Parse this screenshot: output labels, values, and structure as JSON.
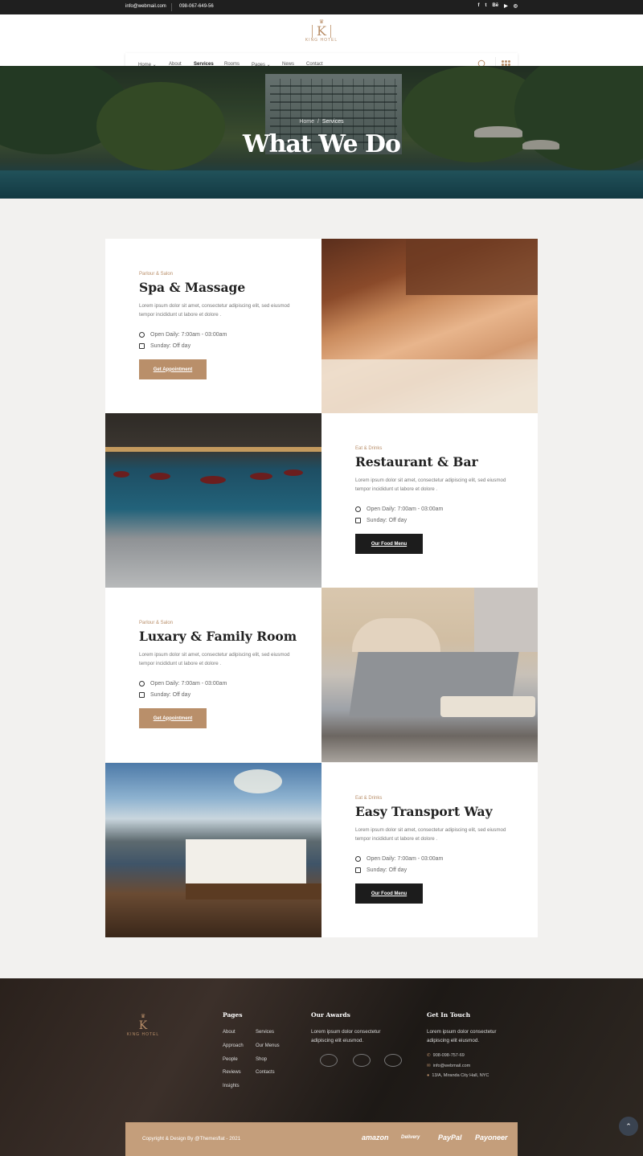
{
  "topbar": {
    "email": "info@webmail.com",
    "phone": "098-067-649-56",
    "social": [
      "f",
      "t",
      "Bē",
      "▶",
      "◎"
    ]
  },
  "logo": {
    "letter": "K",
    "name": "KING HOTEL"
  },
  "nav": {
    "items": [
      "Home",
      "About",
      "Services",
      "Rooms",
      "Pages",
      "News",
      "Contact"
    ],
    "active": "Services"
  },
  "hero": {
    "breadcrumb_home": "Home",
    "breadcrumb_current": "Services",
    "title": "What We Do"
  },
  "services": [
    {
      "category": "Parlour & Salon",
      "title": "Spa & Massage",
      "desc": "Lorem ipsum dolor sit amet, consectetur adipiscing elit, sed eiusmod tempor incididunt ut labore et dolore .",
      "hours": "Open Daily: 7:00am - 03:00am",
      "sunday": "Sunday: Off day",
      "button": "Get Appointment"
    },
    {
      "category": "Eat & Drinks",
      "title": "Restaurant & Bar",
      "desc": "Lorem ipsum dolor sit amet, consectetur adipiscing elit, sed eiusmod tempor incididunt ut labore et dolore .",
      "hours": "Open Daily: 7:00am - 03:00am",
      "sunday": "Sunday: Off day",
      "button": "Our Food Menu"
    },
    {
      "category": "Parlour & Salon",
      "title": "Luxary & Family Room",
      "desc": "Lorem ipsum dolor sit amet, consectetur adipiscing elit, sed eiusmod tempor incididunt ut labore et dolore .",
      "hours": "Open Daily: 7:00am - 03:00am",
      "sunday": "Sunday: Off day",
      "button": "Get Appointment"
    },
    {
      "category": "Eat & Drinks",
      "title": "Easy Transport Way",
      "desc": "Lorem ipsum dolor sit amet, consectetur adipiscing elit, sed eiusmod tempor incididunt ut labore et dolore .",
      "hours": "Open Daily: 7:00am - 03:00am",
      "sunday": "Sunday: Off day",
      "button": "Our Food Menu"
    }
  ],
  "footer": {
    "pages_title": "Pages",
    "pages_col1": [
      "About",
      "Approach",
      "People",
      "Reviews",
      "Insights"
    ],
    "pages_col2": [
      "Services",
      "Our Menus",
      "Shop",
      "Contacts"
    ],
    "awards_title": "Our Awards",
    "awards_text": "Lorem ipsum dolor  consectetur adipiscing elit eiusmod.",
    "touch_title": "Get In Touch",
    "touch_text": "Lorem ipsum dolor  consectetur adipiscing elit eiusmod.",
    "phone": "908-098-757-69",
    "email": "info@webmail.com",
    "address": "13/A, Miranda City Hall, NYC"
  },
  "copyright": "Copyright & Design By @Themesflat - 2021",
  "payments": [
    "amazon",
    "Delivery",
    "PayPal",
    "Payoneer"
  ],
  "colors": {
    "accent": "#b98f6a",
    "dark": "#1c1c1c"
  }
}
